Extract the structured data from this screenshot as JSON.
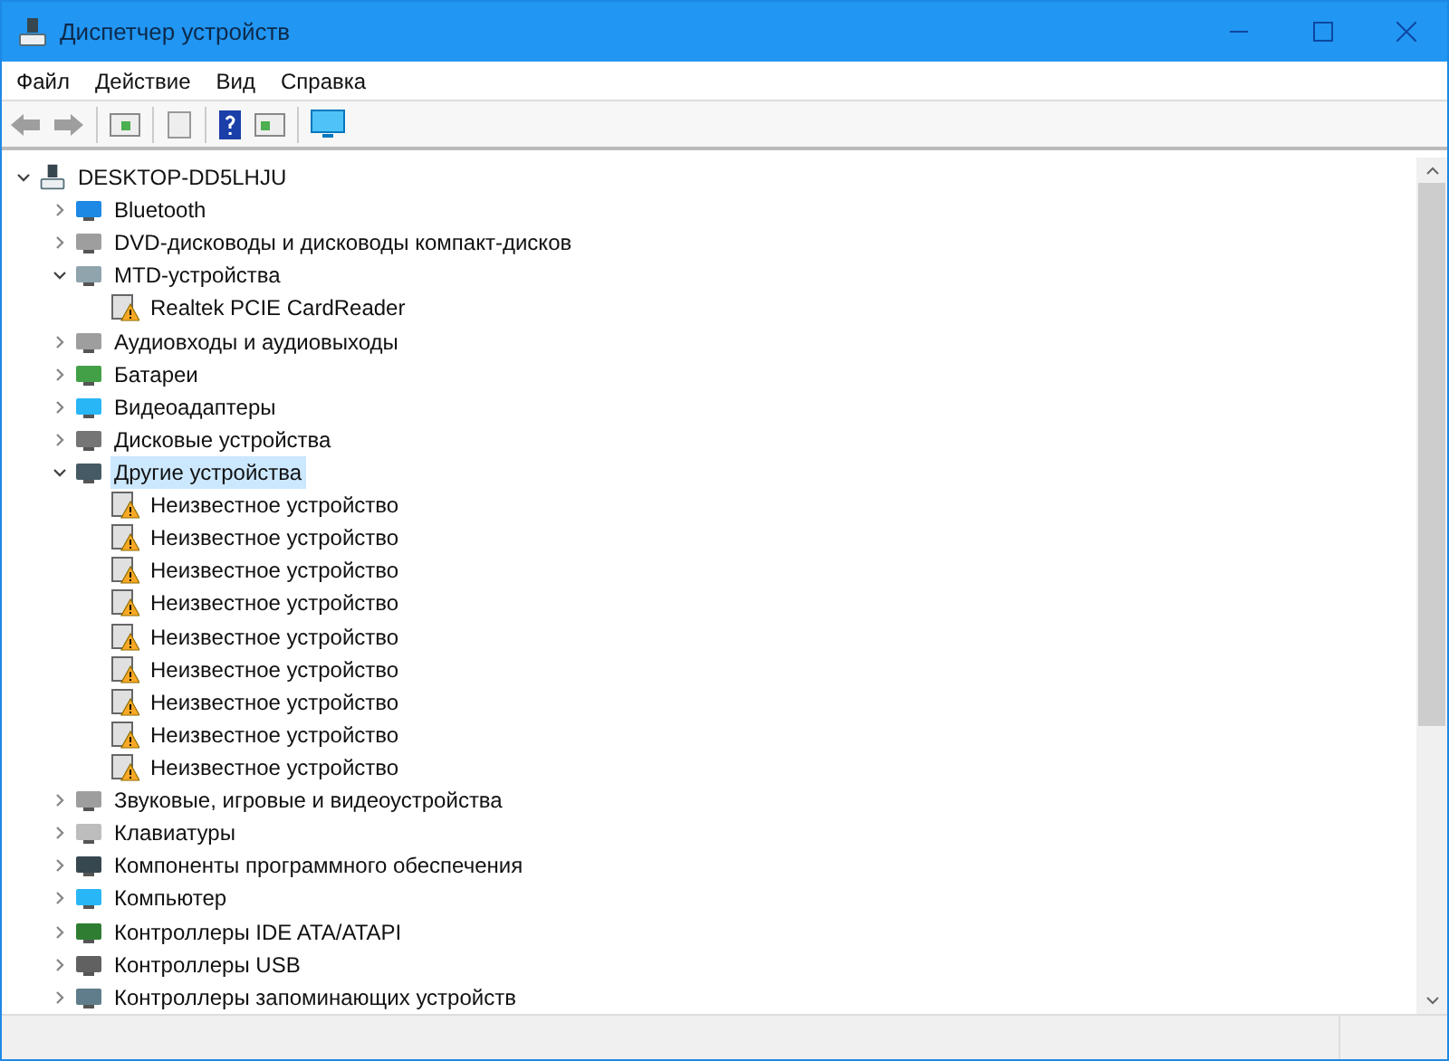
{
  "window": {
    "title": "Диспетчер устройств"
  },
  "menu": [
    "Файл",
    "Действие",
    "Вид",
    "Справка"
  ],
  "tree": {
    "label": "DESKTOP-DD5LHJU",
    "expanded": true,
    "selected": false,
    "children": [
      {
        "label": "Bluetooth",
        "expanded": false,
        "selected": false
      },
      {
        "label": "DVD-дисководы и дисководы компакт-дисков",
        "expanded": false,
        "selected": false
      },
      {
        "label": "MTD-устройства",
        "expanded": true,
        "selected": false,
        "children": [
          {
            "label": "Realtek PCIE CardReader",
            "warning": true,
            "selected": false
          }
        ]
      },
      {
        "label": "Аудиовходы и аудиовыходы",
        "expanded": false,
        "selected": false
      },
      {
        "label": "Батареи",
        "expanded": false,
        "selected": false
      },
      {
        "label": "Видеоадаптеры",
        "expanded": false,
        "selected": false
      },
      {
        "label": "Дисковые устройства",
        "expanded": false,
        "selected": false
      },
      {
        "label": "Другие устройства",
        "expanded": true,
        "selected": true,
        "children": [
          {
            "label": "Неизвестное устройство",
            "warning": true,
            "selected": false
          },
          {
            "label": "Неизвестное устройство",
            "warning": true,
            "selected": false
          },
          {
            "label": "Неизвестное устройство",
            "warning": true,
            "selected": false
          },
          {
            "label": "Неизвестное устройство",
            "warning": true,
            "selected": false
          },
          {
            "label": "Неизвестное устройство",
            "warning": true,
            "selected": false
          },
          {
            "label": "Неизвестное устройство",
            "warning": true,
            "selected": false
          },
          {
            "label": "Неизвестное устройство",
            "warning": true,
            "selected": false
          },
          {
            "label": "Неизвестное устройство",
            "warning": true,
            "selected": false
          },
          {
            "label": "Неизвестное устройство",
            "warning": true,
            "selected": false
          }
        ]
      },
      {
        "label": "Звуковые, игровые и видеоустройства",
        "expanded": false,
        "selected": false
      },
      {
        "label": "Клавиатуры",
        "expanded": false,
        "selected": false
      },
      {
        "label": "Компоненты программного обеспечения",
        "expanded": false,
        "selected": false
      },
      {
        "label": "Компьютер",
        "expanded": false,
        "selected": false
      },
      {
        "label": "Контроллеры IDE ATA/ATAPI",
        "expanded": false,
        "selected": false
      },
      {
        "label": "Контроллеры USB",
        "expanded": false,
        "selected": false
      },
      {
        "label": "Контроллеры запоминающих устройств",
        "expanded": false,
        "selected": false
      }
    ]
  }
}
